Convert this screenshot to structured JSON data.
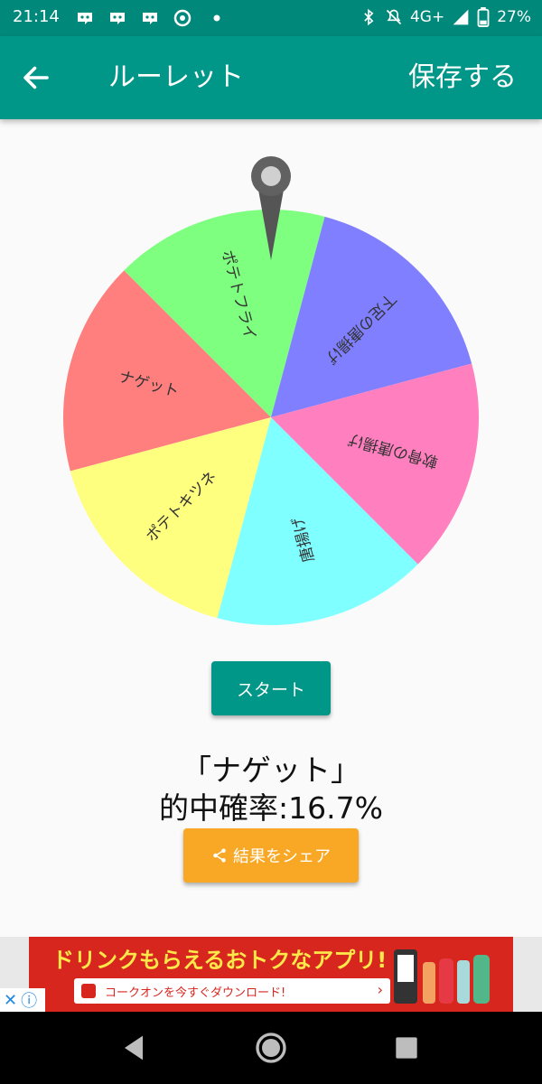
{
  "status_bar": {
    "time": "21:14",
    "network": "4G+",
    "battery": "27%"
  },
  "app_bar": {
    "title": "ルーレット",
    "save_label": "保存する",
    "color": "#009688"
  },
  "roulette": {
    "segments": [
      {
        "label": "ナゲット",
        "color": "#ff7f7f"
      },
      {
        "label": "ポテトフライ",
        "color": "#7fff7f"
      },
      {
        "label": "下足の唐揚げ",
        "color": "#7f7fff"
      },
      {
        "label": "軟骨の唐揚げ",
        "color": "#ff7fbf"
      },
      {
        "label": "唐揚げ",
        "color": "#7fffff"
      },
      {
        "label": "ポテトキツネ",
        "color": "#ffff7f"
      }
    ]
  },
  "start_button": {
    "label": "スタート"
  },
  "result": {
    "text": "「ナゲット」",
    "probability": "的中確率:16.7%"
  },
  "share_button": {
    "label": "結果をシェア",
    "color": "#f9a825"
  },
  "ad": {
    "headline": "ドリンクもらえるおトクなアプリ!",
    "cta": "コークオンを今すぐダウンロード!"
  }
}
